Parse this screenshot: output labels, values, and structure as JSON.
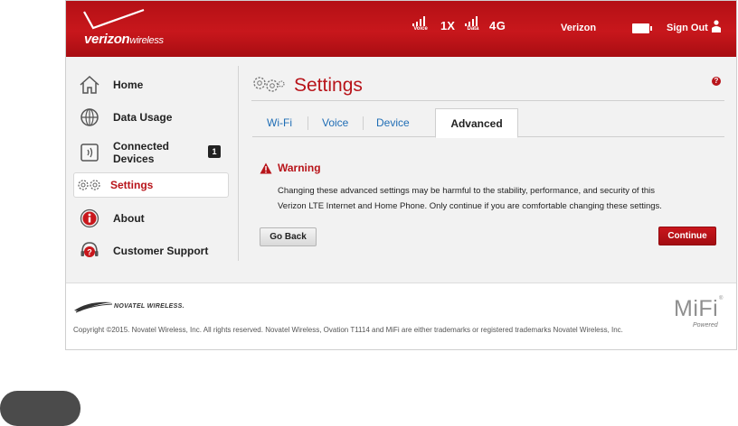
{
  "header": {
    "brand": "verizon",
    "brand_suffix": "wireless",
    "signal_voice_caption": "Voice",
    "signal_data_caption": "Data",
    "network_1x": "1X",
    "network_4g": "4G",
    "carrier": "Verizon",
    "sign_out": "Sign Out"
  },
  "sidebar": {
    "items": [
      {
        "label": "Home",
        "icon": "home-icon"
      },
      {
        "label": "Data Usage",
        "icon": "globe-icon"
      },
      {
        "label": "Connected Devices",
        "icon": "devices-icon",
        "badge": "1"
      },
      {
        "label": "Settings",
        "icon": "gears-icon",
        "active": true
      },
      {
        "label": "About",
        "icon": "info-icon"
      },
      {
        "label": "Customer Support",
        "icon": "support-icon"
      }
    ],
    "connected_label_line1": "Connected",
    "connected_label_line2": "Devices"
  },
  "main": {
    "title": "Settings",
    "help": "?",
    "tabs": [
      "Wi-Fi",
      "Voice",
      "Device",
      "Advanced"
    ],
    "active_tab": "Advanced",
    "warning_title": "Warning",
    "warning_line1": "Changing these advanced settings may be harmful to the stability, performance, and security of this",
    "warning_line2": "Verizon LTE Internet and Home Phone. Only continue if you are comfortable changing these settings.",
    "go_back": "Go Back",
    "continue": "Continue"
  },
  "footer": {
    "partner_logo_text": "NOVATEL WIRELESS.",
    "mifi": "MiFi",
    "mifi_reg": "®",
    "powered": "Powered",
    "copyright": "Copyright ©2015. Novatel Wireless, Inc. All rights reserved. Novatel Wireless, Ovation T1114 and MiFi are either trademarks or registered trademarks Novatel Wireless, Inc."
  },
  "colors": {
    "brand_red": "#b8141a",
    "link_blue": "#1f6db5",
    "page_bg": "#f2f2f2"
  }
}
